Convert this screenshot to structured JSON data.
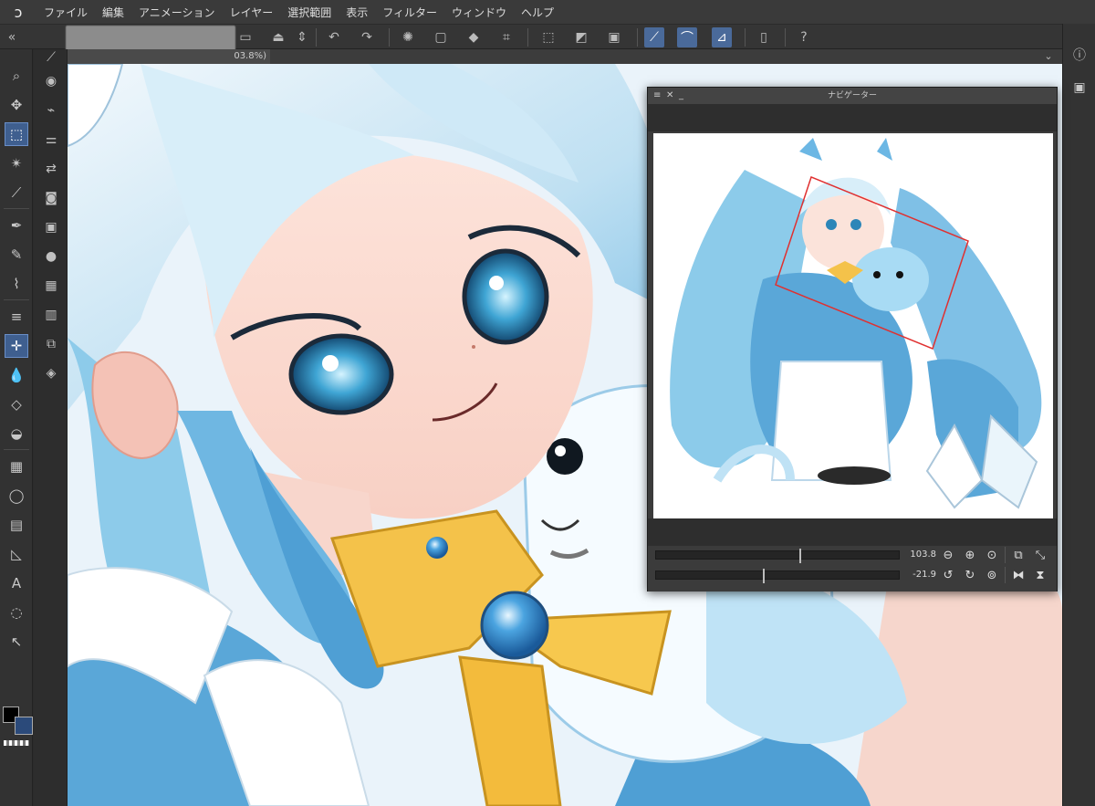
{
  "menu": {
    "items": [
      "ファイル",
      "編集",
      "アニメーション",
      "レイヤー",
      "選択範囲",
      "表示",
      "フィルター",
      "ウィンドウ",
      "ヘルプ"
    ]
  },
  "canvas_tab": {
    "label": "03.8%)"
  },
  "navigator": {
    "title": "ナビゲーター",
    "zoom_value": "103.8",
    "rotation_value": "-21.9",
    "zoom_slider_fraction": 0.59,
    "rotation_slider_fraction": 0.44
  },
  "colors": {
    "main_color": "#000000",
    "sub_color": "#2b4a7a",
    "accent": "#4a6a9a",
    "viewport_frame": "#e03030"
  },
  "icons": {
    "app_logo": "clip-studio-logo",
    "file_open": "folder-open-icon",
    "save": "save-icon",
    "undo": "undo-icon",
    "redo": "redo-icon",
    "help": "help-icon",
    "info": "info-icon"
  }
}
